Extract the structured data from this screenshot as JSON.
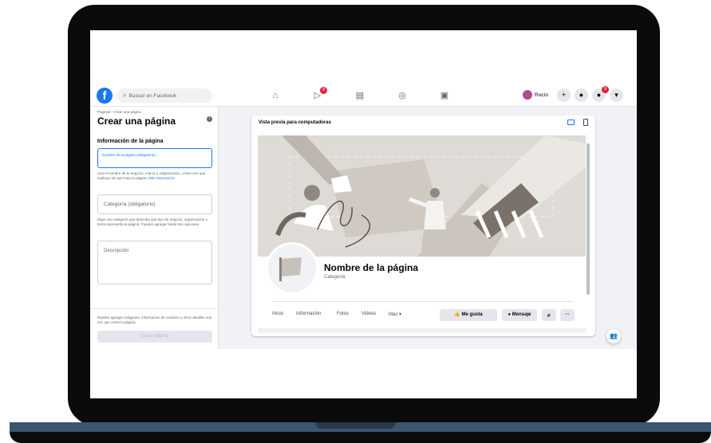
{
  "topbar": {
    "search_placeholder": "Buscar en Facebook",
    "logo": "f",
    "nav": [
      {
        "icon": "home-icon",
        "glyph": "⌂"
      },
      {
        "icon": "watch-icon",
        "glyph": "▷",
        "badge": "9"
      },
      {
        "icon": "marketplace-icon",
        "glyph": "▤"
      },
      {
        "icon": "groups-icon",
        "glyph": "◎"
      },
      {
        "icon": "gaming-icon",
        "glyph": "▣"
      }
    ],
    "user_name": "Rocío",
    "add_glyph": "+",
    "messenger_glyph": "●",
    "notif_glyph": "●",
    "notif_badge": "9",
    "menu_glyph": "▾"
  },
  "left": {
    "breadcrumb": "Páginas › Crear una página",
    "title": "Crear una página",
    "info_glyph": "i",
    "section_heading": "Información de la página",
    "name_field": "Nombre de la página (obligatorio)",
    "name_help": "Usa el nombre de tu negocio, marca u organización, o bien uno que explique de qué trata la página.",
    "name_help_link": "Más información",
    "category_field": "Categoría (obligatorio)",
    "category_help": "Elige una categoría que describa qué tipo de negocio, organización o tema representa la página. Puedes agregar hasta tres opciones.",
    "description_field": "Descripción",
    "footer_note": "Puedes agregar imágenes, información de contacto y otros detalles una vez que crees la página.",
    "create_button": "Crear página"
  },
  "preview": {
    "header": "Vista previa para computadoras",
    "page_name": "Nombre de la página",
    "category": "Categoría",
    "tabs": [
      "Inicio",
      "Información",
      "Fotos",
      "Videos",
      "Más ▾"
    ],
    "like_button": "👍 Me gusta",
    "message_button": "● Mensaje",
    "search_glyph": "⌕",
    "more_glyph": "···"
  },
  "colors": {
    "brand": "#1877f2",
    "badge": "#e41e3f"
  }
}
